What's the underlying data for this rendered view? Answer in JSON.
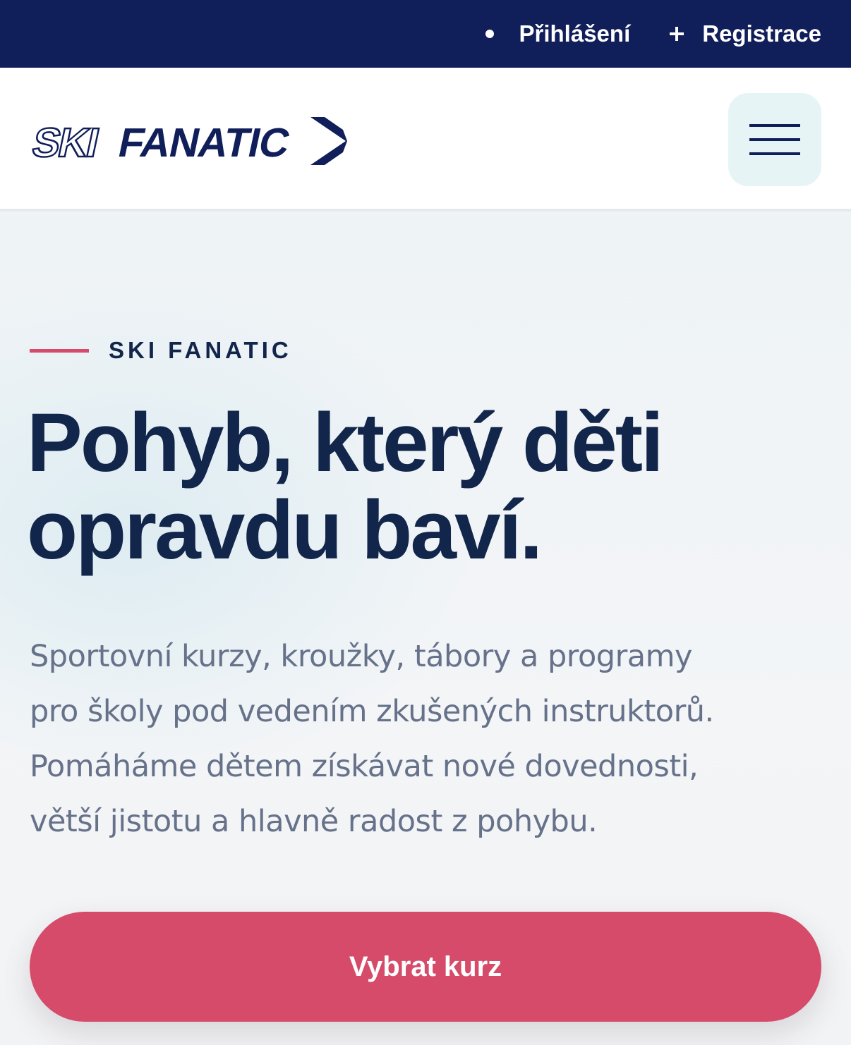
{
  "topbar": {
    "login_label": "Přihlášení",
    "register_label": "Registrace",
    "background_color": "#101e5a"
  },
  "header": {
    "logo_alt": "SKI FANATIC",
    "menu_icon": "hamburger-icon"
  },
  "hero": {
    "eyebrow": "SKI FANATIC",
    "headline_line1": "Pohyb, který děti",
    "headline_line2": "opravdu baví.",
    "lead_line1": "Sportovní kurzy, kroužky, tábory a programy",
    "lead_line2": "pro školy pod vedením zkušených instruktorů.",
    "lead_line3": "Pomáháme dětem získávat nové dovednosti,",
    "lead_line4": "větší jistotu a hlavně radost z pohybu.",
    "cta_label": "Vybrat kurz"
  },
  "colors": {
    "navy": "#101e5a",
    "accent": "#d54b69",
    "text_muted": "#66718a",
    "menu_bg": "#e6f4f6"
  }
}
